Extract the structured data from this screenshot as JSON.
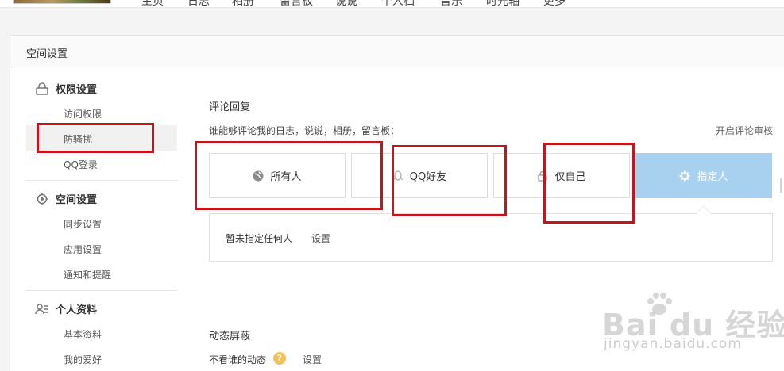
{
  "topnav": {
    "items": [
      "主页",
      "日志",
      "相册",
      "留言板",
      "说说",
      "个人档",
      "音乐",
      "时光轴",
      "更多"
    ]
  },
  "panel": {
    "title": "空间设置"
  },
  "sidebar": {
    "groups": [
      {
        "label": "权限设置",
        "icon": "lock-icon",
        "items": [
          "访问权限",
          "防骚扰",
          "QQ登录"
        ]
      },
      {
        "label": "空间设置",
        "icon": "gear-icon",
        "items": [
          "同步设置",
          "应用设置",
          "通知和提醒"
        ]
      },
      {
        "label": "个人资料",
        "icon": "profile-icon",
        "items": [
          "基本资料",
          "我的爱好"
        ]
      }
    ],
    "active_item": "防骚扰"
  },
  "comment": {
    "title": "评论回复",
    "subtitle": "谁能够评论我的日志，说说，相册，留言板：",
    "review_link": "开启评论审核",
    "options": [
      {
        "label": "所有人",
        "icon": "globe-icon"
      },
      {
        "label": "QQ好友",
        "icon": "qq-icon"
      },
      {
        "label": "仅自己",
        "icon": "lock-icon"
      },
      {
        "label": "指定人",
        "icon": "gear-icon"
      }
    ],
    "selected": "指定人",
    "assign_empty": "暂未指定任何人",
    "assign_setting": "设置"
  },
  "dynamic_block": {
    "title": "动态屏蔽",
    "label": "不看谁的动态",
    "help": "?",
    "setting": "设置"
  },
  "watermark": {
    "logo": "Bai du 经验",
    "url": "jingyan.baidu.com"
  },
  "colors": {
    "selected_bg": "#a8d1ef",
    "annotation": "#c0161e",
    "help": "#f2c05b"
  }
}
